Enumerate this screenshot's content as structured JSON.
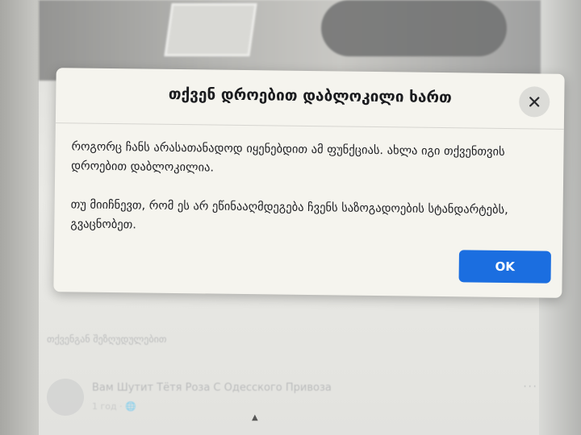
{
  "dialog": {
    "title": "თქვენ დროებით დაბლოკილი ხართ",
    "close_icon": "close-icon",
    "paragraph_1": "როგორც ჩანს არასათანადოდ იყენებდით ამ ფუნქციას. ახლა იგი თქვენთვის დროებით დაბლოკილია.",
    "paragraph_2": "თუ მიიჩნევთ, რომ ეს არ ეწინააღმდეგება ჩვენს საზოგადოების სტანდარტებს, გვაცნობეთ.",
    "ok_label": "OK"
  },
  "background": {
    "feed_text": "თქვენგან შეზღუდულებით",
    "post_author": "Вам Шутит Тётя Роза С Одесского Привоза",
    "post_meta": "1 год · 🌐",
    "post_more": "···"
  },
  "colors": {
    "accent": "#1b6ee0",
    "dialog_bg": "#f5f4ee"
  }
}
